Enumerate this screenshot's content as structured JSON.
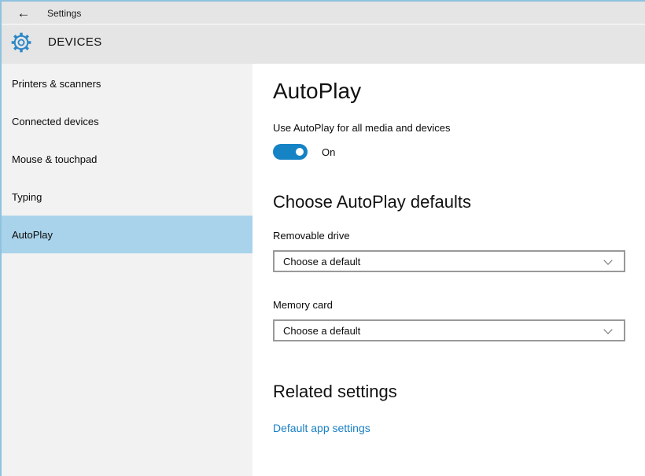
{
  "window": {
    "titlebar": {
      "back_icon": "←",
      "title": "Settings"
    },
    "header": {
      "app_title": "DEVICES"
    }
  },
  "sidebar": {
    "items": [
      {
        "label": "Printers & scanners",
        "selected": false
      },
      {
        "label": "Connected devices",
        "selected": false
      },
      {
        "label": "Mouse & touchpad",
        "selected": false
      },
      {
        "label": "Typing",
        "selected": false
      },
      {
        "label": "AutoPlay",
        "selected": true
      }
    ]
  },
  "main": {
    "title": "AutoPlay",
    "toggle_section": {
      "label": "Use AutoPlay for all media and devices",
      "state": "on",
      "state_label": "On"
    },
    "defaults_section": {
      "title": "Choose AutoPlay defaults",
      "fields": [
        {
          "label": "Removable drive",
          "value": "Choose a default"
        },
        {
          "label": "Memory card",
          "value": "Choose a default"
        }
      ]
    },
    "related_section": {
      "title": "Related settings",
      "link": "Default app settings"
    }
  },
  "colors": {
    "accent_toggle": "#1583c4",
    "accent_gear": "#2b88c8",
    "sidebar_selected": "#a9d3ea",
    "header_bg": "#e5e5e5",
    "sidebar_bg": "#f2f2f2",
    "link": "#1a80c4",
    "frame_border": "#8fc2de",
    "dropdown_border": "#999999"
  }
}
